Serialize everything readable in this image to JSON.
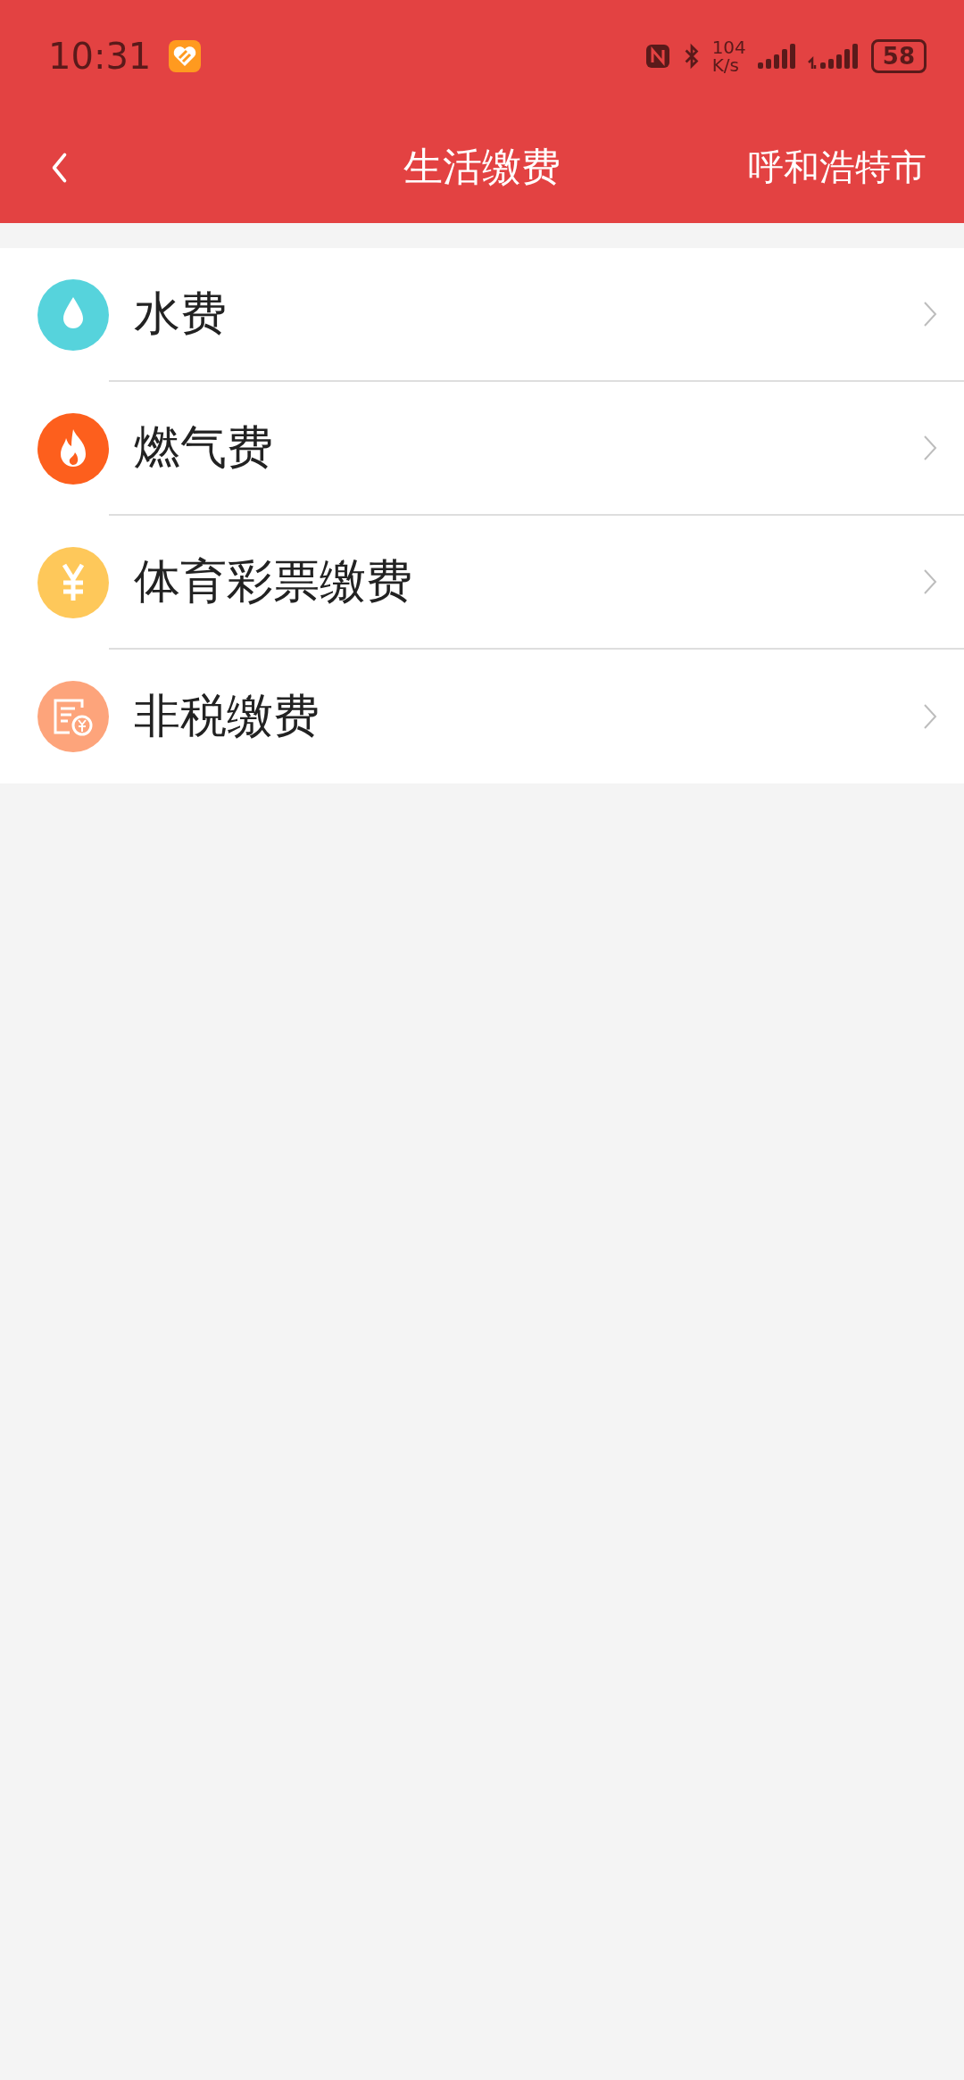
{
  "status_bar": {
    "time": "10:31",
    "net_speed_value": "104",
    "net_speed_unit": "K/s",
    "battery": "58"
  },
  "header": {
    "title": "生活缴费",
    "city": "呼和浩特市"
  },
  "items": [
    {
      "label": "水费",
      "kind": "water",
      "color": "#56d3dc"
    },
    {
      "label": "燃气费",
      "kind": "gas",
      "color": "#fd5f1d"
    },
    {
      "label": "体育彩票缴费",
      "kind": "lottery",
      "color": "#fec85a"
    },
    {
      "label": "非税缴费",
      "kind": "nontax",
      "color": "#fda47b"
    }
  ]
}
